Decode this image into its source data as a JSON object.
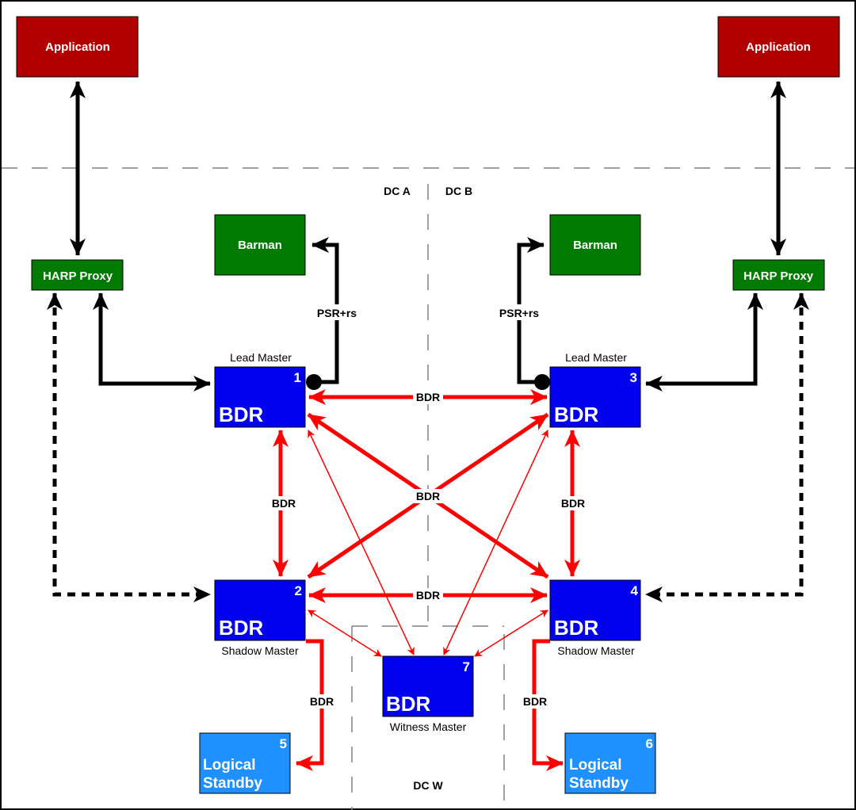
{
  "zones": {
    "dc_a": "DC A",
    "dc_b": "DC B",
    "dc_w": "DC W"
  },
  "colors": {
    "application": "#b00000",
    "green": "#007a00",
    "bdr": "#0000ee",
    "standby": "#1e90ff",
    "replication": "#ff0000",
    "client": "#000000",
    "divider": "#808080"
  },
  "nodes": {
    "app_left": {
      "label": "Application"
    },
    "app_right": {
      "label": "Application"
    },
    "harp_left": {
      "label": "HARP Proxy"
    },
    "harp_right": {
      "label": "HARP Proxy"
    },
    "barman_left": {
      "label": "Barman"
    },
    "barman_right": {
      "label": "Barman"
    },
    "n1": {
      "label": "BDR",
      "number": "1",
      "role": "Lead Master"
    },
    "n2": {
      "label": "BDR",
      "number": "2",
      "role": "Shadow Master"
    },
    "n3": {
      "label": "BDR",
      "number": "3",
      "role": "Lead Master"
    },
    "n4": {
      "label": "BDR",
      "number": "4",
      "role": "Shadow Master"
    },
    "n5": {
      "line1": "Logical",
      "line2": "Standby",
      "number": "5"
    },
    "n6": {
      "line1": "Logical",
      "line2": "Standby",
      "number": "6"
    },
    "n7": {
      "label": "BDR",
      "number": "7",
      "role": "Witness Master"
    }
  },
  "edges": {
    "psr_left": "PSR+rs",
    "psr_right": "PSR+rs",
    "bdr_1_3": "BDR",
    "bdr_cross": "BDR",
    "bdr_2_4": "BDR",
    "bdr_1_2": "BDR",
    "bdr_3_4": "BDR",
    "bdr_2_5": "BDR",
    "bdr_4_6": "BDR"
  }
}
